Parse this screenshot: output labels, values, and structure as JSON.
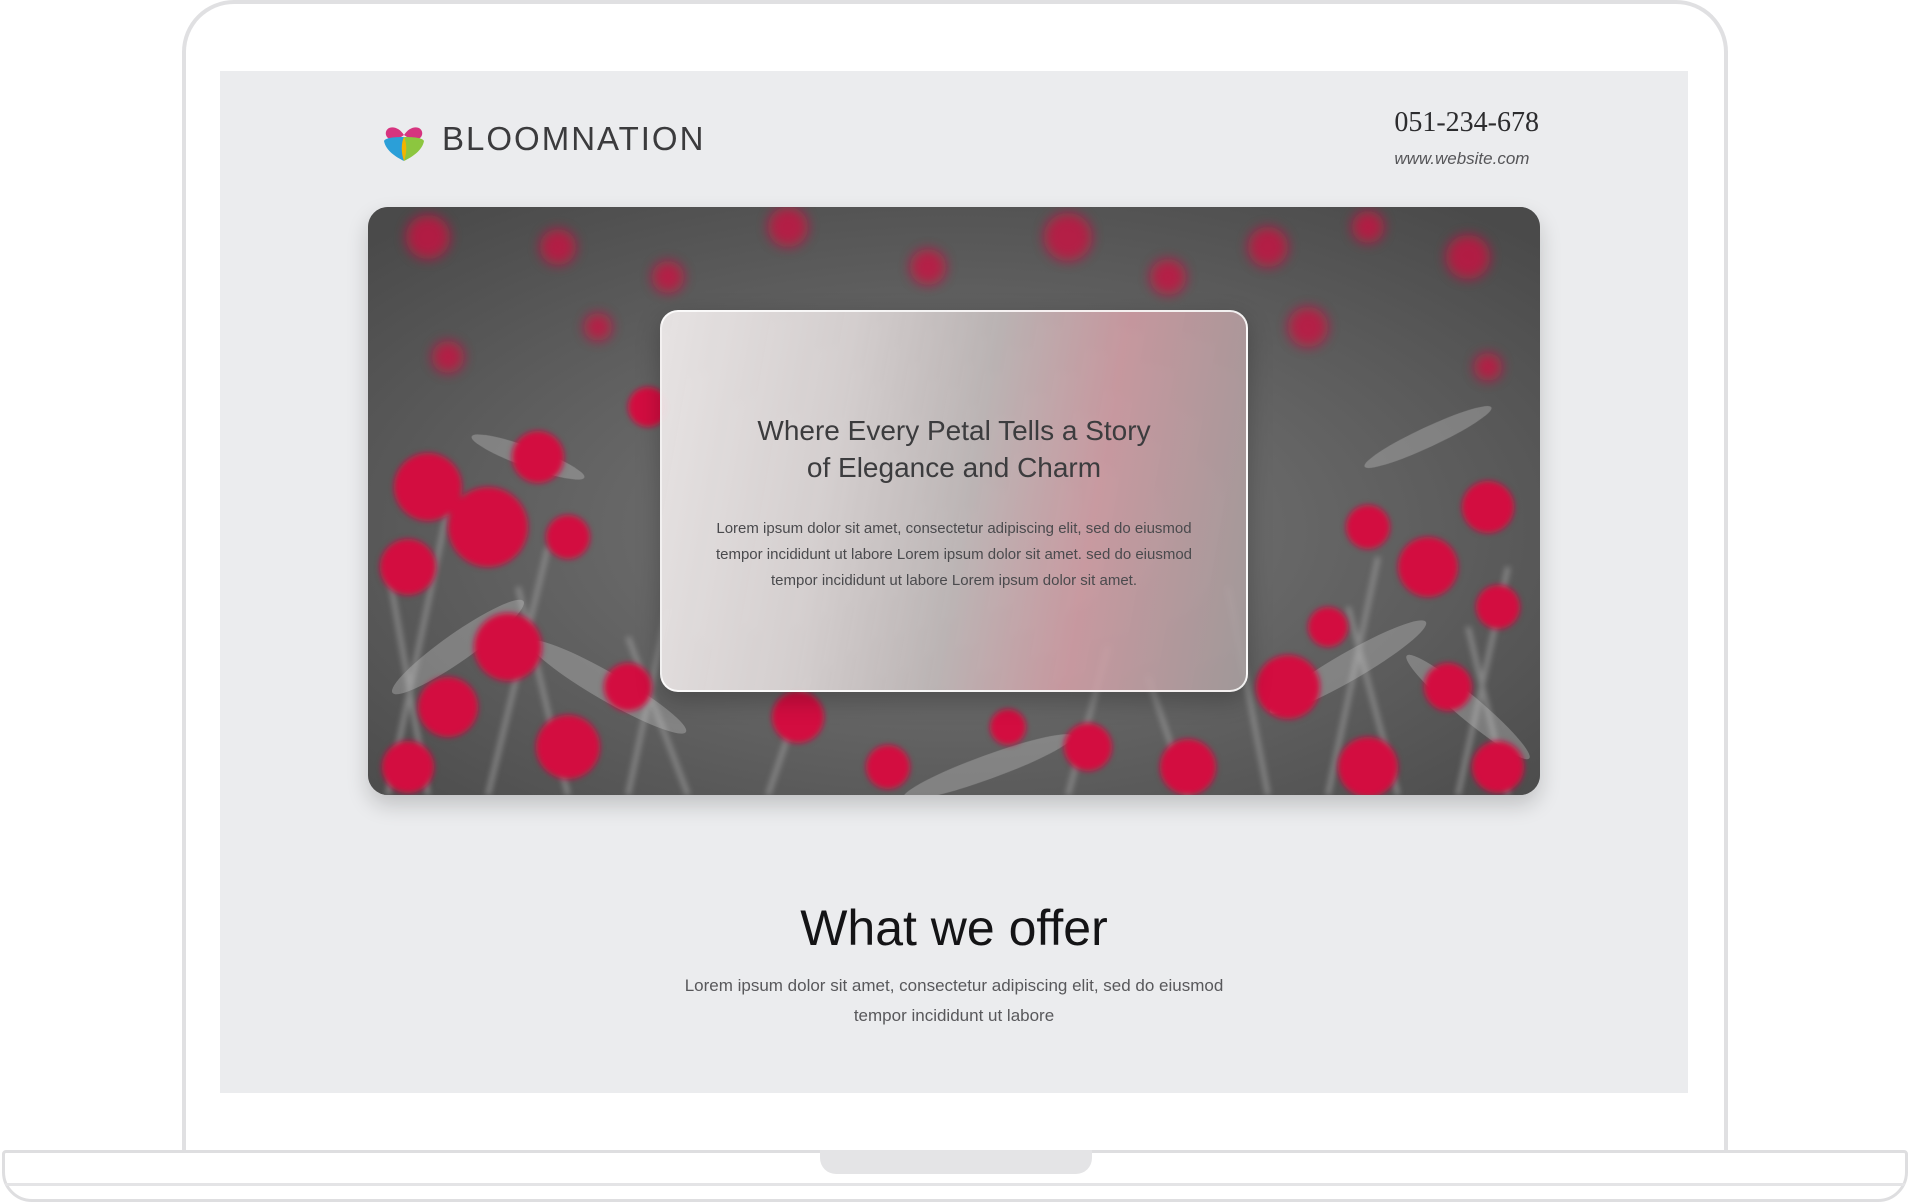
{
  "brand": {
    "name": "BLOOMNATION",
    "colors": {
      "heart_top": "#d6347f",
      "heart_left": "#2b9fd8",
      "heart_right": "#8cc63f",
      "heart_center": "#f2b400"
    }
  },
  "contact": {
    "phone": "051-234-678",
    "website": "www.website.com"
  },
  "hero": {
    "title_line1": "Where Every Petal Tells a Story",
    "title_line2": "of Elegance and Charm",
    "body_line1": "Lorem ipsum dolor sit amet, consectetur adipiscing elit, sed do eiusmod",
    "body_line2": "tempor incididunt ut labore Lorem ipsum dolor sit amet. sed do eiusmod",
    "body_line3": "tempor incididunt ut labore Lorem ipsum dolor sit amet.",
    "accent_color": "#d3113f"
  },
  "offer": {
    "title": "What we offer",
    "body_line1": "Lorem ipsum dolor sit amet, consectetur adipiscing elit, sed do eiusmod",
    "body_line2": "tempor incididunt ut labore"
  }
}
